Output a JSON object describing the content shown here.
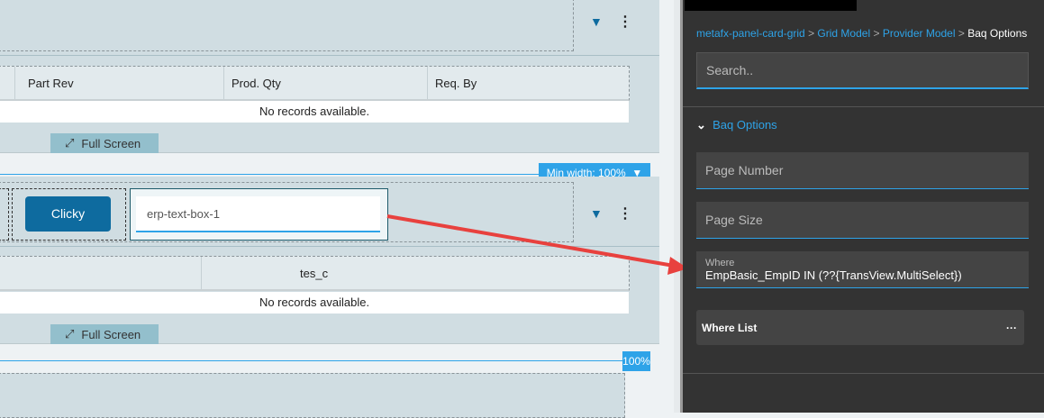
{
  "grid1": {
    "columns": [
      "Part Rev",
      "Prod. Qty",
      "Req. By"
    ],
    "empty": "No records available.",
    "fullscreen": "Full Screen"
  },
  "toolbar": {
    "min_width": "Min width: 100%",
    "percent": "100%"
  },
  "card2": {
    "button": "Clicky",
    "textbox": "erp-text-box-1"
  },
  "grid2": {
    "columns": [
      "tes_c"
    ],
    "empty": "No records available.",
    "fullscreen": "Full Screen"
  },
  "panel": {
    "breadcrumb": [
      "metafx-panel-card-grid",
      "Grid Model",
      "Provider Model",
      "Baq Options"
    ],
    "separator": ">",
    "search_placeholder": "Search..",
    "section": "Baq Options",
    "fields": {
      "page_number": "Page Number",
      "page_size": "Page Size",
      "where_label": "Where",
      "where_value": "EmpBasic_EmpID IN (??{TransView.MultiSelect})",
      "where_list": "Where List",
      "more": "···"
    }
  },
  "colors": {
    "accent": "#2ea3e8",
    "button": "#0e6b9f",
    "arrow": "#e8413e",
    "panel": "#333333"
  }
}
